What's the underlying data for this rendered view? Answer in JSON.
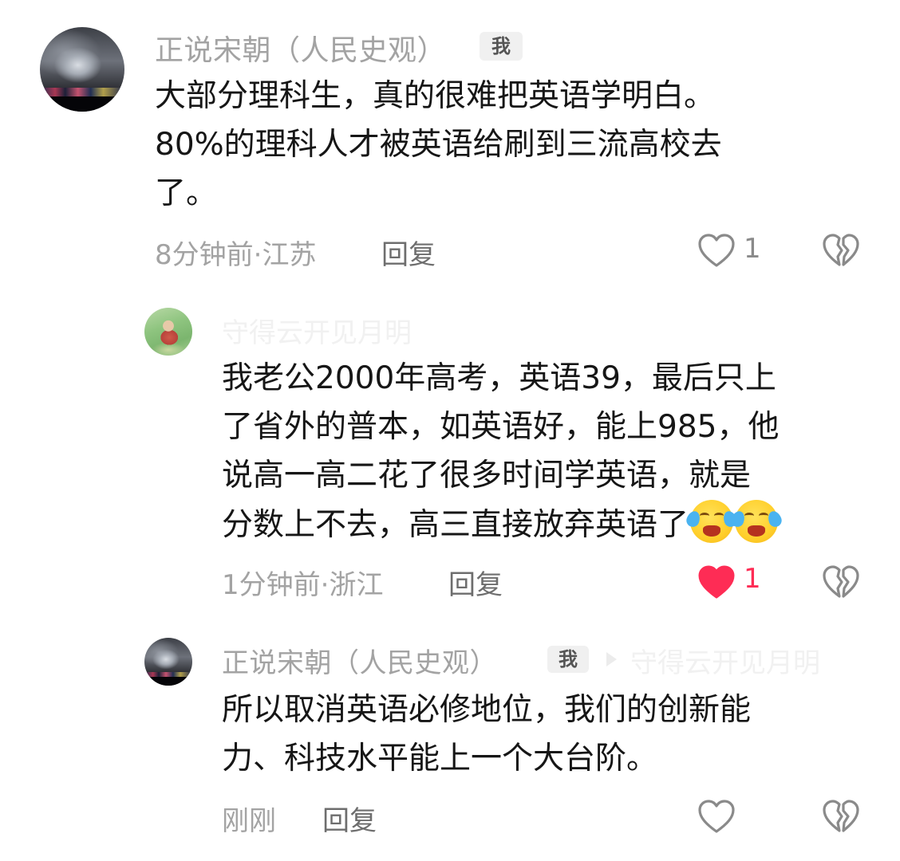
{
  "comments": [
    {
      "username": "正说宋朝（人民史观）",
      "me_badge": "我",
      "text_lines": [
        "大部分理科生，真的很难把英语学明白。",
        "80%的理科人才被英语给刷到三流高校去",
        "了。"
      ],
      "time_location": "8分钟前·江苏",
      "reply_label": "回复",
      "like_count": "1",
      "liked": false
    },
    {
      "username": "守得云开见月明",
      "text_lines": [
        "我老公2000年高考，英语39，最后只上",
        "了省外的普本，如英语好，能上985，他",
        "说高一高二花了很多时间学英语，就是",
        "分数上不去，高三直接放弃英语了"
      ],
      "emoji": [
        "loudly-crying-face",
        "loudly-crying-face"
      ],
      "time_location": "1分钟前·浙江",
      "reply_label": "回复",
      "like_count": "1",
      "liked": true
    },
    {
      "username": "正说宋朝（人民史观）",
      "me_badge": "我",
      "reply_to": "守得云开见月明",
      "text_lines": [
        "所以取消英语必修地位，我们的创新能",
        "力、科技水平能上一个大台阶。"
      ],
      "time_location": "刚刚",
      "reply_label": "回复",
      "like_count": "",
      "liked": false
    }
  ],
  "icons": {
    "like": "heart-outline-icon",
    "liked": "heart-filled-icon",
    "dislike": "broken-heart-icon"
  },
  "colors": {
    "like_active": "#fe2c55",
    "muted_text": "#a3a3a3"
  }
}
